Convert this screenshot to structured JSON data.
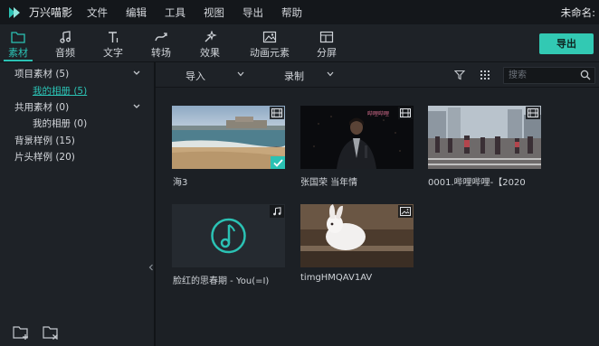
{
  "app": {
    "name": "万兴喵影",
    "doc_title": "未命名:"
  },
  "menu": [
    "文件",
    "编辑",
    "工具",
    "视图",
    "导出",
    "帮助"
  ],
  "tabs": [
    {
      "label": "素材",
      "icon": "folder-icon",
      "active": true
    },
    {
      "label": "音频",
      "icon": "music-note-icon",
      "active": false
    },
    {
      "label": "文字",
      "icon": "text-icon",
      "active": false
    },
    {
      "label": "转场",
      "icon": "transition-icon",
      "active": false
    },
    {
      "label": "效果",
      "icon": "effects-icon",
      "active": false
    },
    {
      "label": "动画元素",
      "icon": "image-icon",
      "active": false
    },
    {
      "label": "分屏",
      "icon": "split-screen-icon",
      "active": false
    }
  ],
  "export_label": "导出",
  "sidebar": {
    "items": [
      {
        "label": "项目素材 (5)",
        "expandable": true
      },
      {
        "label": "我的相册 (5)",
        "selected": true
      },
      {
        "label": "共用素材 (0)",
        "expandable": true
      },
      {
        "label": "我的相册 (0)"
      },
      {
        "label": "背景样例 (15)"
      },
      {
        "label": "片头样例 (20)"
      }
    ]
  },
  "subbar": {
    "import_label": "导入",
    "record_label": "录制",
    "search_placeholder": "搜索"
  },
  "media": [
    {
      "caption": "海3",
      "type": "video",
      "checked": true
    },
    {
      "caption": "张国荣 当年情",
      "type": "video",
      "overlay_text": "哔哩哔哩"
    },
    {
      "caption": "0001.哔哩哔哩-【2020",
      "type": "video"
    },
    {
      "caption": "脸红的思春期 - You(=I)",
      "type": "audio"
    },
    {
      "caption": "timgHMQAV1AV",
      "type": "image"
    }
  ],
  "colors": {
    "accent": "#2bc2b4",
    "export_button": "#32c9b3",
    "background": "#1e2227"
  }
}
